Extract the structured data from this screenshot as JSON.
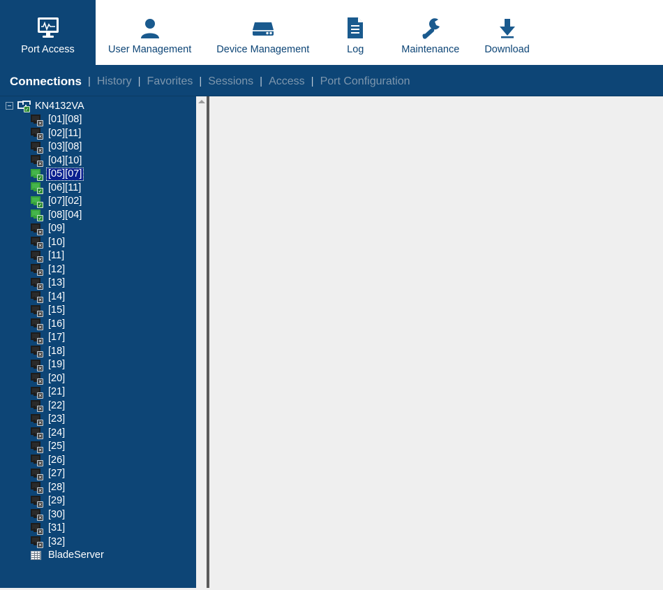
{
  "top_nav": {
    "items": [
      {
        "label": "Port Access",
        "icon": "monitor-pulse-icon",
        "active": true
      },
      {
        "label": "User Management",
        "icon": "user-icon",
        "active": false
      },
      {
        "label": "Device Management",
        "icon": "server-icon",
        "active": false
      },
      {
        "label": "Log",
        "icon": "document-icon",
        "active": false
      },
      {
        "label": "Maintenance",
        "icon": "wrench-icon",
        "active": false
      },
      {
        "label": "Download",
        "icon": "download-arrow-icon",
        "active": false
      }
    ]
  },
  "sub_nav": {
    "separator": "|",
    "items": [
      {
        "label": "Connections",
        "active": true
      },
      {
        "label": "History",
        "active": false
      },
      {
        "label": "Favorites",
        "active": false
      },
      {
        "label": "Sessions",
        "active": false
      },
      {
        "label": "Access",
        "active": false
      },
      {
        "label": "Port Configuration",
        "active": false
      }
    ]
  },
  "tree": {
    "root": {
      "label": "KN4132VA",
      "icon": "kvm-switch-online-icon",
      "expanded": true
    },
    "nodes": [
      {
        "label": "[01][08]",
        "status": "offline",
        "selected": false
      },
      {
        "label": "[02][11]",
        "status": "offline",
        "selected": false
      },
      {
        "label": "[03][08]",
        "status": "offline",
        "selected": false
      },
      {
        "label": "[04][10]",
        "status": "offline",
        "selected": false
      },
      {
        "label": "[05][07]",
        "status": "online",
        "selected": true
      },
      {
        "label": "[06][11]",
        "status": "online",
        "selected": false
      },
      {
        "label": "[07][02]",
        "status": "online",
        "selected": false
      },
      {
        "label": "[08][04]",
        "status": "online",
        "selected": false
      },
      {
        "label": "[09]",
        "status": "offline",
        "selected": false
      },
      {
        "label": "[10]",
        "status": "offline",
        "selected": false
      },
      {
        "label": "[11]",
        "status": "offline",
        "selected": false
      },
      {
        "label": "[12]",
        "status": "offline",
        "selected": false
      },
      {
        "label": "[13]",
        "status": "offline",
        "selected": false
      },
      {
        "label": "[14]",
        "status": "offline",
        "selected": false
      },
      {
        "label": "[15]",
        "status": "offline",
        "selected": false
      },
      {
        "label": "[16]",
        "status": "offline",
        "selected": false
      },
      {
        "label": "[17]",
        "status": "offline",
        "selected": false
      },
      {
        "label": "[18]",
        "status": "offline",
        "selected": false
      },
      {
        "label": "[19]",
        "status": "offline",
        "selected": false
      },
      {
        "label": "[20]",
        "status": "offline",
        "selected": false
      },
      {
        "label": "[21]",
        "status": "offline",
        "selected": false
      },
      {
        "label": "[22]",
        "status": "offline",
        "selected": false
      },
      {
        "label": "[23]",
        "status": "offline",
        "selected": false
      },
      {
        "label": "[24]",
        "status": "offline",
        "selected": false
      },
      {
        "label": "[25]",
        "status": "offline",
        "selected": false
      },
      {
        "label": "[26]",
        "status": "offline",
        "selected": false
      },
      {
        "label": "[27]",
        "status": "offline",
        "selected": false
      },
      {
        "label": "[28]",
        "status": "offline",
        "selected": false
      },
      {
        "label": "[29]",
        "status": "offline",
        "selected": false
      },
      {
        "label": "[30]",
        "status": "offline",
        "selected": false
      },
      {
        "label": "[31]",
        "status": "offline",
        "selected": false
      },
      {
        "label": "[32]",
        "status": "offline",
        "selected": false
      },
      {
        "label": "BladeServer",
        "status": "rack",
        "selected": false
      }
    ]
  },
  "colors": {
    "brand_blue": "#0d4576",
    "panel_grey": "#efefef",
    "divider_grey": "#5a5a5a",
    "selection_blue": "#0a1f8f",
    "online_green": "#45b54b",
    "inactive_tab_text": "#7d96ad"
  }
}
